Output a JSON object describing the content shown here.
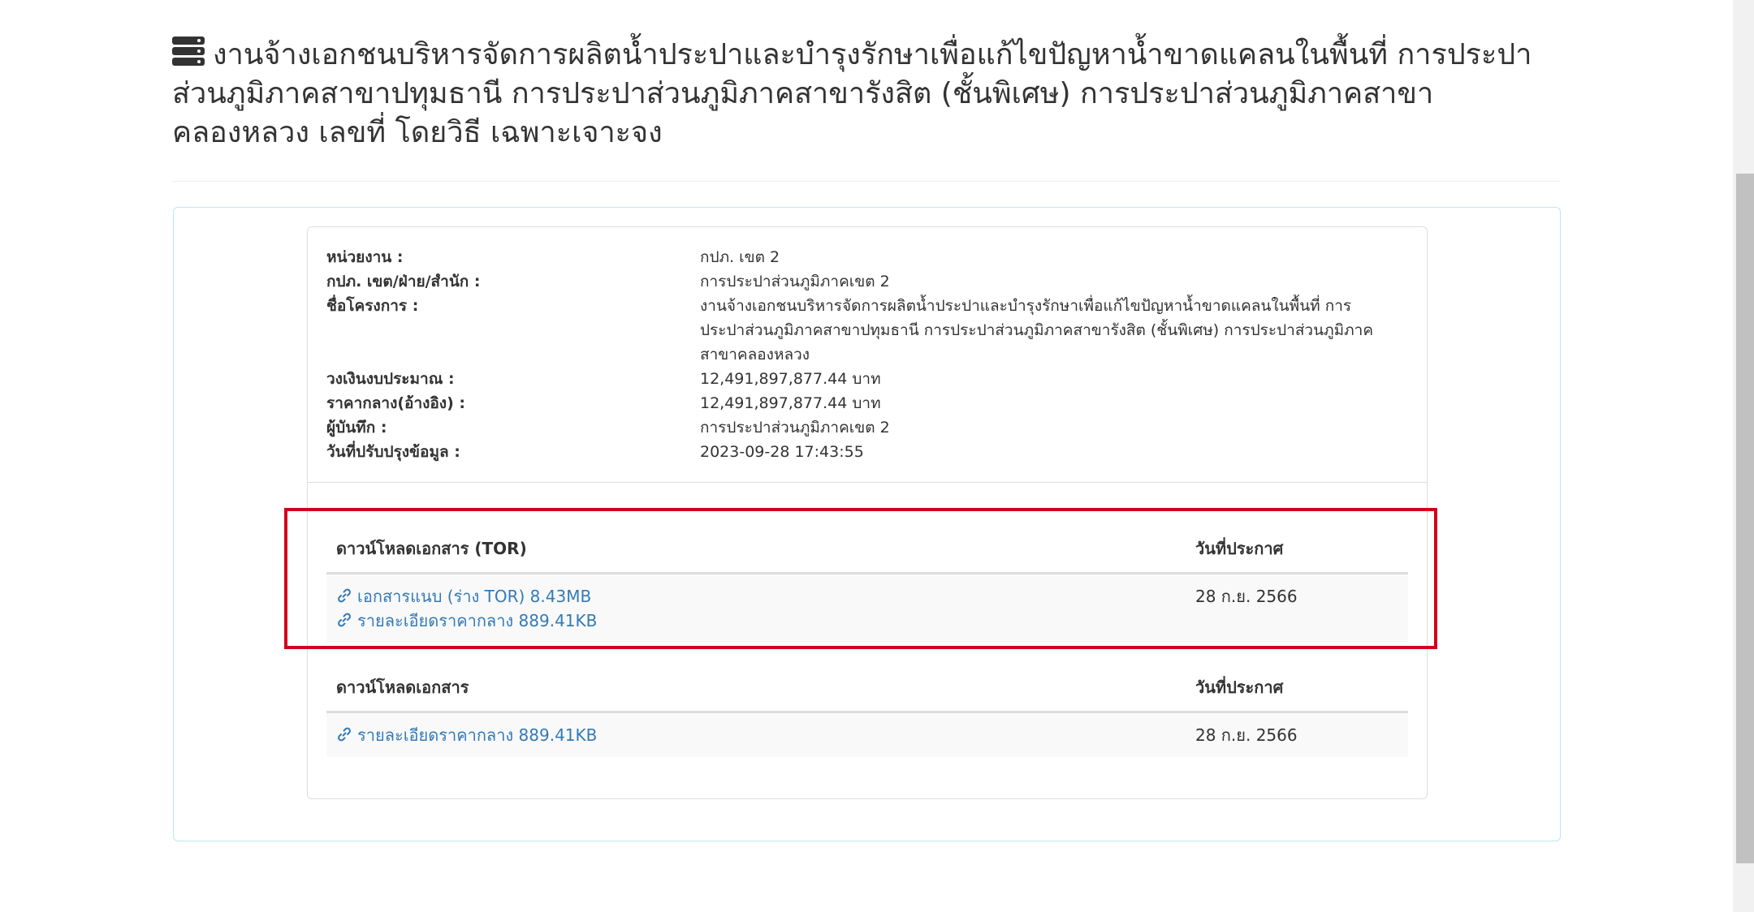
{
  "header": {
    "title": "งานจ้างเอกชนบริหารจัดการผลิตน้ำประปาและบำรุงรักษาเพื่อแก้ไขปัญหาน้ำขาดแคลนในพื้นที่ การประปาส่วนภูมิภาคสาขาปทุมธานี การประปาส่วนภูมิภาคสาขารังสิต (ชั้นพิเศษ) การประปาส่วนภูมิภาคสาขาคลองหลวง เลขที่ โดยวิธี เฉพาะเจาะจง",
    "icon": "server-stack-icon"
  },
  "info": [
    {
      "label": "หน่วยงาน :",
      "value": "กปภ. เขต 2"
    },
    {
      "label": "กปภ. เขต/ฝ่าย/สำนัก :",
      "value": "การประปาส่วนภูมิภาคเขต 2"
    },
    {
      "label": "ชื่อโครงการ :",
      "value": "งานจ้างเอกชนบริหารจัดการผลิตน้ำประปาและบำรุงรักษาเพื่อแก้ไขปัญหาน้ำขาดแคลนในพื้นที่ การประปาส่วนภูมิภาคสาขาปทุมธานี การประปาส่วนภูมิภาคสาขารังสิต (ชั้นพิเศษ) การประปาส่วนภูมิภาคสาขาคลองหลวง"
    },
    {
      "label": "วงเงินงบประมาณ :",
      "value": "12,491,897,877.44 บาท"
    },
    {
      "label": "ราคากลาง(อ้างอิง) :",
      "value": "12,491,897,877.44 บาท"
    },
    {
      "label": "ผู้บันทึก :",
      "value": "การประปาส่วนภูมิภาคเขต 2"
    },
    {
      "label": "วันที่ปรับปรุงข้อมูล :",
      "value": "2023-09-28 17:43:55"
    }
  ],
  "tor_table": {
    "header_doc": "ดาวน์โหลดเอกสาร (TOR)",
    "header_date": "วันที่ประกาศ",
    "links": [
      "เอกสารแนบ (ร่าง TOR) 8.43MB",
      "รายละเอียดราคากลาง 889.41KB"
    ],
    "date": "28 ก.ย. 2566"
  },
  "docs_table": {
    "header_doc": "ดาวน์โหลดเอกสาร",
    "header_date": "วันที่ประกาศ",
    "links": [
      "รายละเอียดราคากลาง 889.41KB"
    ],
    "date": "28 ก.ย. 2566"
  },
  "colors": {
    "link": "#337ab7",
    "highlight": "#d0021b",
    "panel_border": "#bce8f1"
  }
}
